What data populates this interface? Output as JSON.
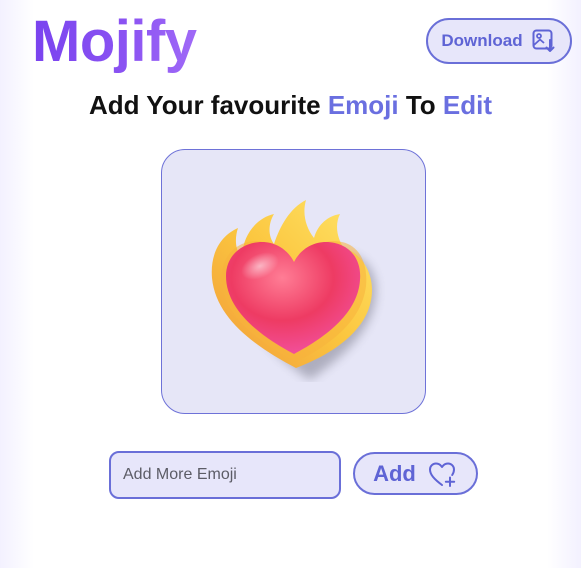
{
  "header": {
    "logo_text": "Mojify",
    "download_label": "Download",
    "download_icon": "image-download-icon"
  },
  "heading": {
    "part1": "Add Your favourite ",
    "emphasis1": "Emoji",
    "part2": " To ",
    "emphasis2": "Edit"
  },
  "preview": {
    "emoji": "heart-on-fire-emoji"
  },
  "composer": {
    "input_value": "",
    "input_placeholder": "Add More Emoji",
    "add_label": "Add",
    "add_icon": "heart-plus-icon"
  },
  "colors": {
    "accent": "#6a6fe0",
    "logo_gradient_start": "#7a43ef",
    "logo_gradient_end": "#a06af7",
    "panel_bg": "#e7e6fa",
    "border": "#6a6fd8"
  }
}
